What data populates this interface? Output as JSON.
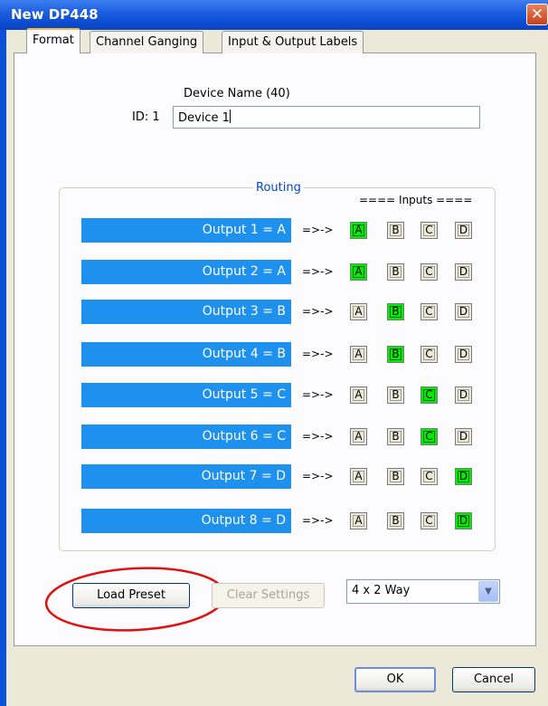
{
  "window": {
    "title": "New DP448",
    "close_glyph": "✕"
  },
  "tabs": [
    {
      "label": "Format",
      "active": true
    },
    {
      "label": "Channel Ganging",
      "active": false
    },
    {
      "label": "Input & Output Labels",
      "active": false
    }
  ],
  "device": {
    "name_label": "Device Name (40)",
    "id_label": "ID: 1",
    "name_value": "Device 1"
  },
  "routing": {
    "title": "Routing",
    "inputs_header": "==== Inputs ====",
    "arrow": "=>->",
    "input_names": [
      "A",
      "B",
      "C",
      "D"
    ],
    "outputs": [
      {
        "label": "Output 1 = A",
        "selected": "A"
      },
      {
        "label": "Output 2 = A",
        "selected": "A"
      },
      {
        "label": "Output 3 = B",
        "selected": "B"
      },
      {
        "label": "Output 4 = B",
        "selected": "B"
      },
      {
        "label": "Output 5 = C",
        "selected": "C"
      },
      {
        "label": "Output 6 = C",
        "selected": "C"
      },
      {
        "label": "Output 7 = D",
        "selected": "D"
      },
      {
        "label": "Output 8 = D",
        "selected": "D"
      }
    ]
  },
  "actions": {
    "load_preset": "Load Preset",
    "clear_settings": "Clear Settings",
    "preset_select_value": "4 x 2 Way"
  },
  "footer": {
    "ok": "OK",
    "cancel": "Cancel"
  },
  "colors": {
    "output_bar": "#1e90ee",
    "selected_input": "#00ee00",
    "annotation_circle": "#e01010",
    "title_bar": "#0a4ad0"
  }
}
